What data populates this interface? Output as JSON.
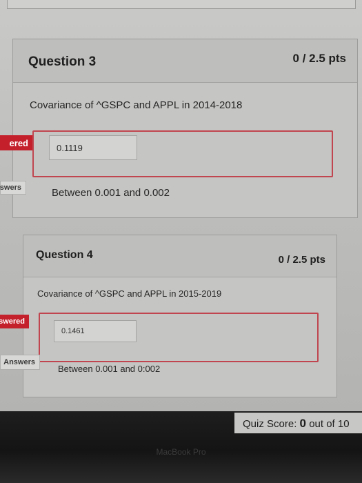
{
  "questions": [
    {
      "title": "Question 3",
      "points": "0 / 2.5 pts",
      "text": "Covariance of ^GSPC and APPL in 2014-2018",
      "answered_tag": "ered",
      "answer_value": "0.1119",
      "correct_tag": "swers",
      "correct_answer": "Between 0.001 and 0.002"
    },
    {
      "title": "Question 4",
      "points": "0 / 2.5 pts",
      "text": "Covariance of ^GSPC and APPL in 2015-2019",
      "answered_tag": "swered",
      "answer_value": "0.1461",
      "correct_tag": "Answers",
      "correct_answer": "Between 0.001 and 0:002"
    }
  ],
  "quiz_score": {
    "label": "Quiz Score:",
    "score": "0",
    "suffix": "out of 10"
  },
  "device_label": "MacBook Pro",
  "colors": {
    "incorrect_red": "#c3202c",
    "answer_border": "#c0454f"
  }
}
